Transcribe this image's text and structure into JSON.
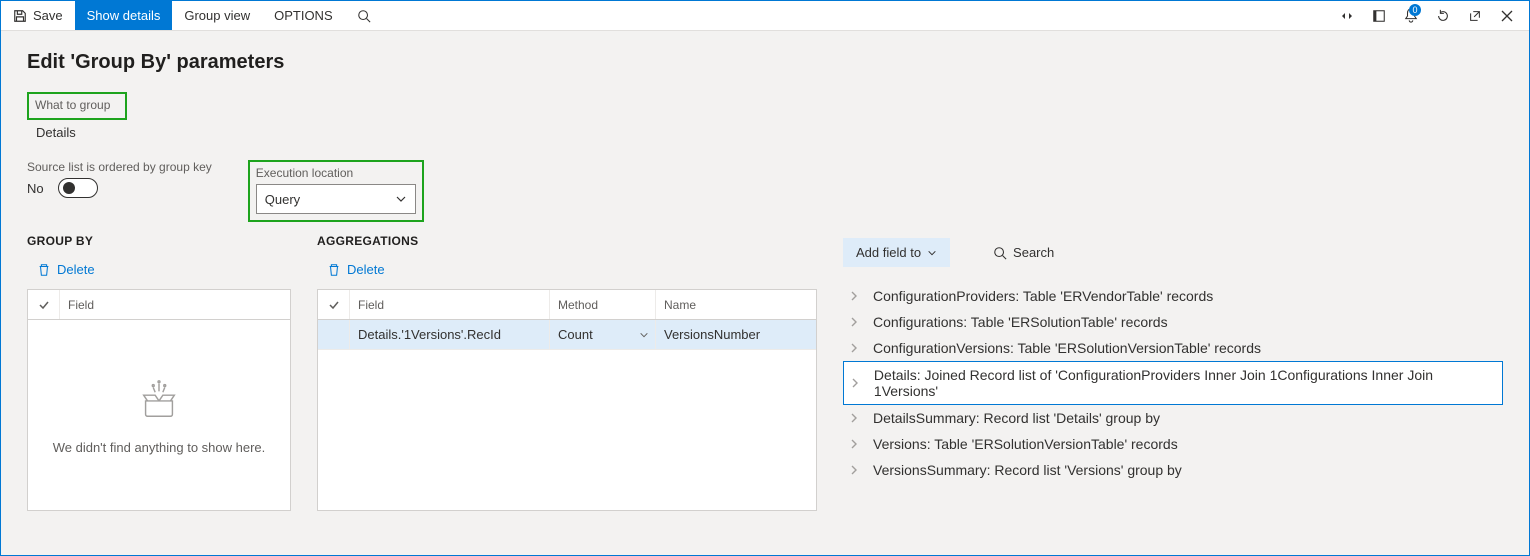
{
  "toolbar": {
    "save": "Save",
    "show_details": "Show details",
    "group_view": "Group view",
    "options": "OPTIONS",
    "notif_count": "0"
  },
  "page": {
    "title": "Edit 'Group By' parameters"
  },
  "what_to_group": {
    "label": "What to group",
    "value": "Details"
  },
  "ordered": {
    "label": "Source list is ordered by group key",
    "value": "No"
  },
  "exec": {
    "label": "Execution location",
    "value": "Query"
  },
  "groupby": {
    "title": "GROUP BY",
    "delete": "Delete",
    "header_field": "Field",
    "empty_text": "We didn't find anything to show here."
  },
  "agg": {
    "title": "AGGREGATIONS",
    "delete": "Delete",
    "header_field": "Field",
    "header_method": "Method",
    "header_name": "Name",
    "row": {
      "field": "Details.'1Versions'.RecId",
      "method": "Count",
      "name": "VersionsNumber"
    }
  },
  "tree": {
    "add_field": "Add field to",
    "search": "Search",
    "items": [
      "ConfigurationProviders: Table 'ERVendorTable' records",
      "Configurations: Table 'ERSolutionTable' records",
      "ConfigurationVersions: Table 'ERSolutionVersionTable' records",
      "Details: Joined Record list of 'ConfigurationProviders Inner Join 1Configurations Inner Join 1Versions'",
      "DetailsSummary: Record list 'Details' group by",
      "Versions: Table 'ERSolutionVersionTable' records",
      "VersionsSummary: Record list 'Versions' group by"
    ],
    "selected_index": 3
  }
}
